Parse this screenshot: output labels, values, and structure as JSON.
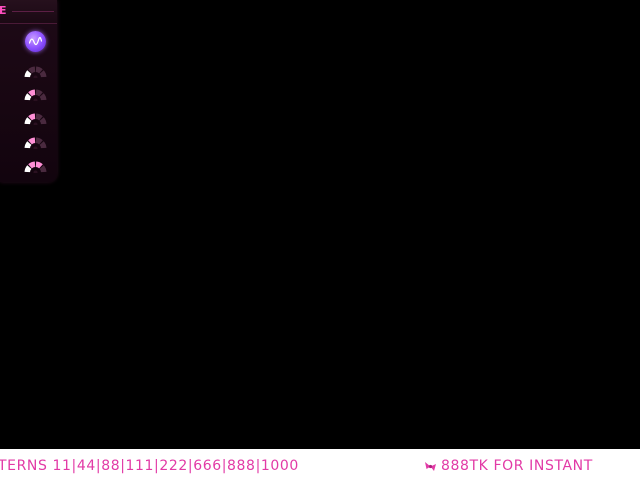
{
  "panel": {
    "header_label": "E",
    "levels": [
      {
        "name": "level-1",
        "active_segments": 1
      },
      {
        "name": "level-2",
        "active_segments": 2
      },
      {
        "name": "level-3",
        "active_segments": 2
      },
      {
        "name": "level-4",
        "active_segments": 2
      },
      {
        "name": "level-5",
        "active_segments": 3
      }
    ]
  },
  "ticker": {
    "left_text": "TERNS 11|44|88|111|222|666|888|1000",
    "right_text": "888TK FOR INSTANT",
    "icon": "pink-bow-icon"
  },
  "colors": {
    "background": "#000000",
    "accent_pink": "#e23aa6",
    "panel_bg": "#1b0914",
    "avatar_purple": "#8a4dff",
    "ticker_bg": "#ffffff"
  }
}
